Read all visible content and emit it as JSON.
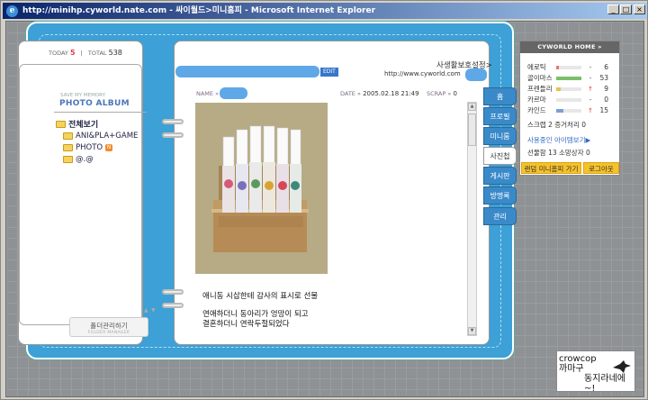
{
  "window": {
    "title": "http://minihp.cyworld.nate.com - 싸이월드>미니홈피 - Microsoft Internet Explorer",
    "buttons": [
      "_",
      "□",
      "×"
    ]
  },
  "visitor": {
    "today_label": "TODAY",
    "today_value": "5",
    "divider": "|",
    "total_label": "TOTAL",
    "total_value": "538"
  },
  "album": {
    "save_label": "SAVE MY MEMORY",
    "title": "PHOTO ALBUM",
    "folders": [
      {
        "label": "전체보기"
      },
      {
        "label": "ANI&PLA+GAME"
      },
      {
        "label": "PHOTO",
        "badge": "N"
      },
      {
        "label": "@.@"
      }
    ],
    "folder_button": "폴더관리하기",
    "folder_button_sub": "FOLDER MANAGER",
    "scroll_up": "▲",
    "scroll_down": "▼"
  },
  "header": {
    "edit_label": "EDIT",
    "site_title": "사생활보호설정>",
    "url": "http://www.cyworld.com"
  },
  "post": {
    "name_label": "NAME",
    "date_label": "DATE",
    "date_value": "2005.02.18 21:49",
    "scrap_label": "SCRAP",
    "scrap_value": "0",
    "arrows": "»",
    "caption_1": "애니동 시삽한테 감사의 표시로 선물",
    "caption_2": "연애하더니 동아리가 엉망이 되고",
    "caption_3": "결혼하더니 연락두절되었다"
  },
  "tabs": [
    {
      "label": "홈"
    },
    {
      "label": "프로필"
    },
    {
      "label": "미니룸"
    },
    {
      "label": "사진첩",
      "active": true
    },
    {
      "label": "게시판"
    },
    {
      "label": "방명록"
    },
    {
      "label": "관리"
    }
  ],
  "sidebar": {
    "head": "CYWORLD HOME",
    "head_icon": "»",
    "moods": [
      {
        "name": "에로틱",
        "value": 6,
        "arrow": "-",
        "color": "#e87878"
      },
      {
        "name": "골이마스",
        "value": 53,
        "arrow": "-",
        "color": "#7bbf6a"
      },
      {
        "name": "프렌들리",
        "value": 9,
        "arrow": "↑",
        "color": "#e4c44a"
      },
      {
        "name": "카르마",
        "value": 0,
        "arrow": "-",
        "color": "#c0c0c0"
      },
      {
        "name": "카인드",
        "value": 15,
        "arrow": "↑",
        "color": "#7aa0d8"
      }
    ],
    "scrap_text": "스크랩 2 증거처리 0",
    "items_link": "사용중인 아이템보기▶",
    "gift_text": "선물함 13 소망상자 0",
    "random_button": "랜덤 미니홈피 가기",
    "logout_button": "로그아웃"
  },
  "watermark": {
    "line_1": "crowcop",
    "line_2": "까마구",
    "line_3": "동지라네에~!"
  }
}
